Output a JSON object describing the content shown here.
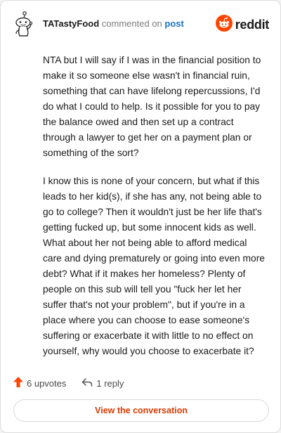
{
  "header": {
    "author": "TATastyFood",
    "action_text": "commented on",
    "post_link": "post",
    "brand": "reddit"
  },
  "comment": {
    "paragraphs": [
      "NTA but I will say if I was in the financial position to make it so someone else wasn't in financial ruin, something that can have lifelong repercussions, I'd do what I could to help. Is it possible for you to pay the balance owed and then set up a contract through a lawyer to get her on a payment plan or something of the sort?",
      "I know this is none of your concern, but what if this leads to her kid(s), if she has any, not being able to go to college? Then it wouldn't just be her life that's getting fucked up, but some innocent kids as well. What about her not being able to afford medical care and dying prematurely or going into even more debt? What if it makes her homeless? Plenty of people on this sub will tell you \"fuck her let her suffer that's not your problem\", but if you're in a place where you can choose to ease someone's suffering or exacerbate it with little to no effect on yourself, why would you choose to exacerbate it?"
    ]
  },
  "actions": {
    "upvotes": "6 upvotes",
    "replies": "1 reply"
  },
  "cta": {
    "label": "View the conversation"
  },
  "colors": {
    "brand_orange": "#ff4500",
    "cta_text": "#d93a00",
    "link_blue": "#1a73c8"
  },
  "icons": [
    "snoo-avatar-icon",
    "reddit-logo-icon",
    "upvote-arrow-icon",
    "reply-arrow-icon"
  ]
}
